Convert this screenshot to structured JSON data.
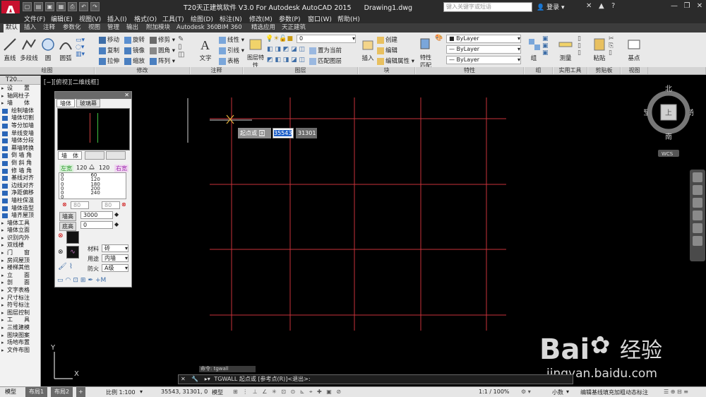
{
  "window": {
    "title": "T20天正建筑软件 V3.0 For Autodesk AutoCAD 2015",
    "drawing": "Drawing1.dwg",
    "search_placeholder": "键入关键字或短语",
    "signin": "登录"
  },
  "logo": "A",
  "menu": [
    "文件(F)",
    "编辑(E)",
    "视图(V)",
    "插入(I)",
    "格式(O)",
    "工具(T)",
    "绘图(D)",
    "标注(N)",
    "修改(M)",
    "参数(P)",
    "窗口(W)",
    "帮助(H)"
  ],
  "ribbon_tabs": [
    {
      "label": "默认",
      "active": true
    },
    {
      "label": "插入"
    },
    {
      "label": "注释"
    },
    {
      "label": "参数化"
    },
    {
      "label": "视图"
    },
    {
      "label": "管理"
    },
    {
      "label": "输出"
    },
    {
      "label": "附加模块"
    },
    {
      "label": "Autodesk 360"
    },
    {
      "label": "BIM 360"
    },
    {
      "label": "精选应用"
    },
    {
      "label": "天正建筑"
    }
  ],
  "ribbon": {
    "draw": {
      "line": "直线",
      "polyline": "多段线",
      "circle": "圆",
      "arc": "圆弧",
      "panel": "绘图"
    },
    "modify": {
      "move": "移动",
      "rotate": "旋转",
      "trim": "修剪",
      "copy": "复制",
      "mirror": "镜像",
      "fillet": "圆角",
      "stretch": "拉伸",
      "scale": "缩放",
      "array": "阵列",
      "panel": "修改"
    },
    "annotation": {
      "text": "文字",
      "dimension": "线性",
      "leader": "引线",
      "table": "表格",
      "panel": "注释"
    },
    "layers": {
      "properties": "图层特性",
      "layer_value": "0",
      "set_current": "置为当前",
      "match": "匹配图层",
      "panel": "图层"
    },
    "block": {
      "insert": "插入",
      "create": "创建",
      "edit": "编辑",
      "edit_attr": "编辑属性",
      "panel": "块"
    },
    "properties": {
      "match": "特性匹配",
      "color": "ByLayer",
      "linetype": "ByLayer",
      "lineweight": "ByLayer",
      "panel": "特性"
    },
    "groups": {
      "group": "组",
      "panel": "组"
    },
    "utilities": {
      "measure": "测量",
      "panel": "实用工具"
    },
    "clipboard": {
      "paste": "粘贴",
      "panel": "剪贴板"
    },
    "view": {
      "base": "基点",
      "panel": "视图"
    }
  },
  "t20": {
    "header": "T20...",
    "items": [
      {
        "label": "设　　置",
        "sec": true
      },
      {
        "label": "轴网柱子",
        "sec": true
      },
      {
        "label": "墙　　体",
        "sec": true
      },
      {
        "label": "绘制墙体"
      },
      {
        "label": "墙体切割"
      },
      {
        "label": "等分加墙"
      },
      {
        "label": "单线变墙"
      },
      {
        "label": "墙体分段"
      },
      {
        "label": "幕墙转换"
      },
      {
        "label": "倒 墙 角"
      },
      {
        "label": "倒 斜 角"
      },
      {
        "label": "修 墙 角"
      },
      {
        "label": "基线对齐"
      },
      {
        "label": "边线对齐"
      },
      {
        "label": "净距偏移"
      },
      {
        "label": "墙柱保温"
      },
      {
        "label": "墙体造型"
      },
      {
        "label": "墙齐屋顶"
      },
      {
        "label": "墙体工具",
        "sec": true
      },
      {
        "label": "墙体立面",
        "sec": true
      },
      {
        "label": "识别内外",
        "sec": true
      },
      {
        "label": "双线楼",
        "sec": true
      },
      {
        "label": "门　　窗",
        "sec": true
      },
      {
        "label": "房间屋顶",
        "sec": true
      },
      {
        "label": "楼梯其他",
        "sec": true
      },
      {
        "label": "立　　面",
        "sec": true
      },
      {
        "label": "剖　　面",
        "sec": true
      },
      {
        "label": "文字表格",
        "sec": true
      },
      {
        "label": "尺寸标注",
        "sec": true
      },
      {
        "label": "符号标注",
        "sec": true
      },
      {
        "label": "图层控制",
        "sec": true
      },
      {
        "label": "工　　具",
        "sec": true
      },
      {
        "label": "三维建模",
        "sec": true
      },
      {
        "label": "图块图案",
        "sec": true
      },
      {
        "label": "场地布置",
        "sec": true
      },
      {
        "label": "文件布图",
        "sec": true
      }
    ]
  },
  "dialog": {
    "tabs": [
      "墙体",
      "玻璃幕"
    ],
    "subtab": "墙　体",
    "left_label": "左宽",
    "left_value": "120",
    "right_value": "120",
    "right_label": "右宽",
    "width_list": [
      "0",
      "0",
      "0",
      "0",
      "0",
      "0"
    ],
    "width_values": [
      "60",
      "120",
      "180",
      "200",
      "240"
    ],
    "offset_left": "80",
    "offset_right": "80",
    "height_label": "墙高",
    "height_value": "3000",
    "base_label": "底高",
    "base_value": "0",
    "material_label": "材料",
    "material_value": "砖",
    "use_label": "用途",
    "use_value": "内墙",
    "fire_label": "防火",
    "fire_value": "A级"
  },
  "viewport": {
    "label": "[−][俯视][二维线框]",
    "prompt": "起点或",
    "input_x": "35543",
    "input_y": "31301",
    "compass": {
      "n": "北",
      "s": "南",
      "e": "东",
      "w": "西",
      "center": "上",
      "wcs": "WCS"
    },
    "axis_x": "X",
    "axis_y": "Y"
  },
  "command": {
    "history": "命令: tgwall",
    "line": "TGWALL 起点或 [参考点(R)]<退出>:"
  },
  "layout_tabs": [
    "模型",
    "布局1",
    "布局2"
  ],
  "status": {
    "scale": "比例 1:100",
    "coords": "35543, 31301, 0",
    "mode": "模型",
    "annoscale": "1:1 / 100%",
    "units": "小数",
    "message": "编辑基线填充加粗动态标注"
  },
  "watermark": {
    "brand": "Bai",
    "suffix": "经验",
    "url": "jingyan.baidu.com"
  },
  "colors": {
    "grid": "#c8323a",
    "accent": "#1e5fc8",
    "logo": "#c8102e"
  }
}
